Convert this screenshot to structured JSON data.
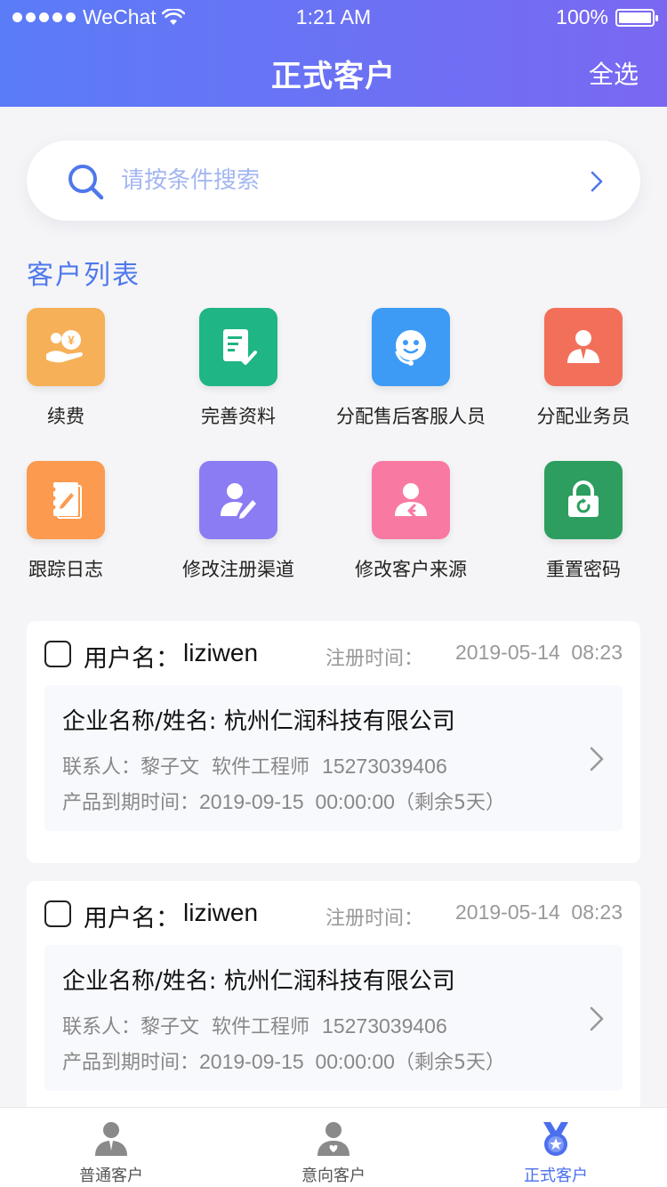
{
  "status_bar": {
    "carrier": "WeChat",
    "time": "1:21 AM",
    "battery": "100%"
  },
  "header": {
    "title": "正式客户",
    "select_all": "全选"
  },
  "search": {
    "placeholder": "请按条件搜索"
  },
  "section": {
    "title": "客户列表"
  },
  "actions": [
    {
      "label": "续费",
      "icon": "renew-money-icon",
      "color": "#f6b058"
    },
    {
      "label": "完善资料",
      "icon": "document-check-icon",
      "color": "#1fb585"
    },
    {
      "label": "分配售后客服人员",
      "icon": "customer-service-icon",
      "color": "#3d9bf5"
    },
    {
      "label": "分配业务员",
      "icon": "salesman-icon",
      "color": "#f2705a"
    },
    {
      "label": "跟踪日志",
      "icon": "notebook-icon",
      "color": "#fc9a50"
    },
    {
      "label": "修改注册渠道",
      "icon": "user-edit-icon",
      "color": "#8b7cf4"
    },
    {
      "label": "修改客户来源",
      "icon": "user-source-icon",
      "color": "#f87aa3"
    },
    {
      "label": "重置密码",
      "icon": "reset-lock-icon",
      "color": "#2d9e5f"
    }
  ],
  "customers": [
    {
      "username_label": "用户名：",
      "username": "liziwen",
      "reg_label": "注册时间：",
      "reg_time": "2019-05-14  08:23",
      "company_label": "企业名称/姓名:",
      "company": "杭州仁润科技有限公司",
      "contact_label": "联系人：",
      "contact_name": "黎子文",
      "contact_title": "软件工程师",
      "phone": "15273039406",
      "expire_label": "产品到期时间：",
      "expire_time": "2019-09-15  00:00:00",
      "remaining": "（剩余5天）"
    },
    {
      "username_label": "用户名：",
      "username": "liziwen",
      "reg_label": "注册时间：",
      "reg_time": "2019-05-14  08:23",
      "company_label": "企业名称/姓名:",
      "company": "杭州仁润科技有限公司",
      "contact_label": "联系人：",
      "contact_name": "黎子文",
      "contact_title": "软件工程师",
      "phone": "15273039406",
      "expire_label": "产品到期时间：",
      "expire_time": "2019-09-15  00:00:00",
      "remaining": "（剩余5天）"
    }
  ],
  "tabs": [
    {
      "label": "普通客户",
      "icon": "regular-customer-icon",
      "active": false
    },
    {
      "label": "意向客户",
      "icon": "prospect-customer-icon",
      "active": false
    },
    {
      "label": "正式客户",
      "icon": "formal-customer-medal-icon",
      "active": true
    }
  ],
  "colors": {
    "accent": "#4f78ec",
    "header_start": "#5b7cf7",
    "header_end": "#7a68f2",
    "tab_active": "#4c6fee"
  }
}
